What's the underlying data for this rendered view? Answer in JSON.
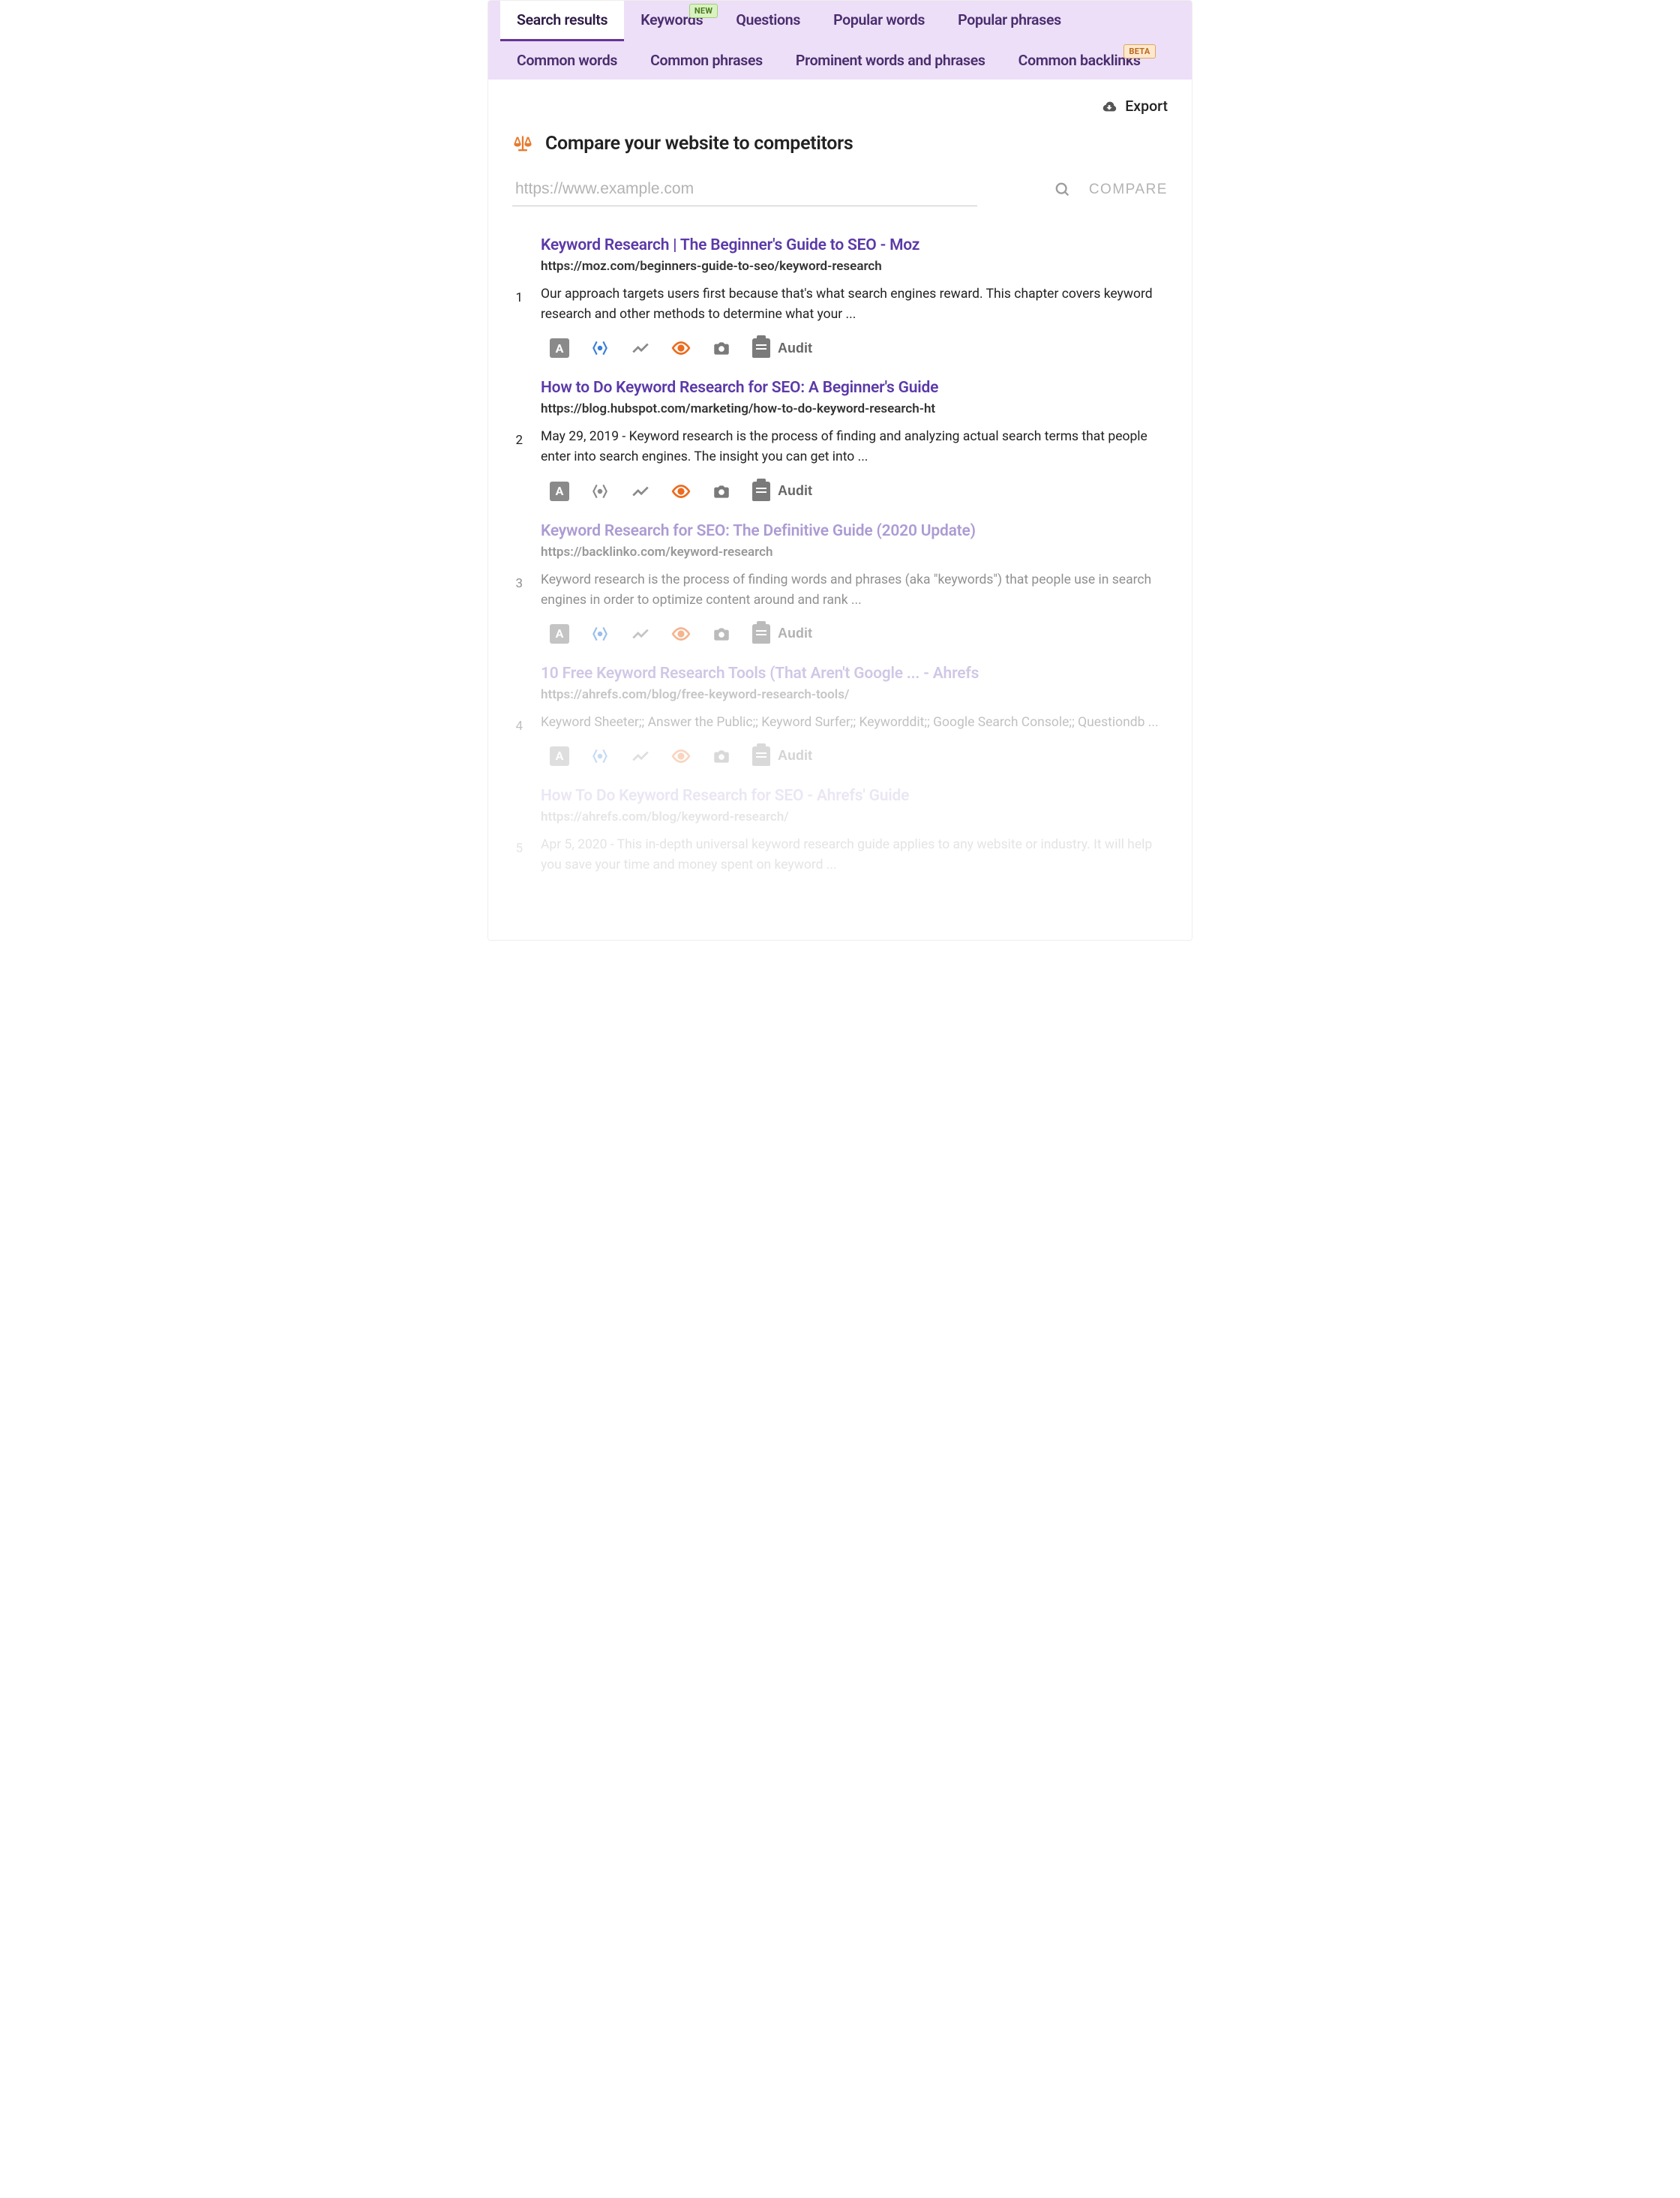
{
  "tabs_row1": [
    {
      "label": "Search results",
      "active": true,
      "name": "tab-search-results"
    },
    {
      "label": "Keywords",
      "badge": "NEW",
      "badge_kind": "new",
      "name": "tab-keywords"
    },
    {
      "label": "Questions",
      "name": "tab-questions"
    },
    {
      "label": "Popular words",
      "name": "tab-popular-words"
    },
    {
      "label": "Popular phrases",
      "name": "tab-popular-phrases"
    }
  ],
  "tabs_row2": [
    {
      "label": "Common words",
      "name": "tab-common-words"
    },
    {
      "label": "Common phrases",
      "name": "tab-common-phrases"
    },
    {
      "label": "Prominent words and phrases",
      "name": "tab-prominent-words-phrases"
    },
    {
      "label": "Common backlinks",
      "badge": "BETA",
      "badge_kind": "beta",
      "name": "tab-common-backlinks"
    }
  ],
  "export_label": "Export",
  "compare": {
    "title": "Compare your website to competitors",
    "placeholder": "https://www.example.com",
    "button": "COMPARE"
  },
  "audit_label": "Audit",
  "results": [
    {
      "num": "1",
      "title": "Keyword Research | The Beginner's Guide to SEO - Moz",
      "url": "https://moz.com/beginners-guide-to-seo/keyword-research",
      "snippet": "Our approach targets users first because that's what search engines reward. This chapter covers keyword research and other methods to determine what your ...",
      "schema_blue": true,
      "fade": ""
    },
    {
      "num": "2",
      "title": "How to Do Keyword Research for SEO: A Beginner's Guide",
      "url": "https://blog.hubspot.com/marketing/how-to-do-keyword-research-ht",
      "snippet": "May 29, 2019 - Keyword research is the process of finding and analyzing actual search terms that people enter into search engines. The insight you can get into ...",
      "schema_blue": false,
      "fade": ""
    },
    {
      "num": "3",
      "title": "Keyword Research for SEO: The Definitive Guide (2020 Update)",
      "url": "https://backlinko.com/keyword-research",
      "snippet": "Keyword research is the process of finding words and phrases (aka \"keywords\") that people use in search engines in order to optimize content around and rank ...",
      "schema_blue": true,
      "fade": "faded"
    },
    {
      "num": "4",
      "title": "10 Free Keyword Research Tools (That Aren't Google ... - Ahrefs",
      "url": "https://ahrefs.com/blog/free-keyword-research-tools/",
      "snippet": "Keyword Sheeter;; Answer the Public;; Keyword Surfer;; Keyworddit;; Google Search Console;; Questiondb ...",
      "schema_blue": true,
      "fade": "faded-more"
    },
    {
      "num": "5",
      "title": "How To Do Keyword Research for SEO - Ahrefs' Guide",
      "url": "https://ahrefs.com/blog/keyword-research/",
      "snippet": "Apr 5, 2020 - This in-depth universal keyword research guide applies to any website or industry. It will help you save your time and money spent on keyword ...",
      "schema_blue": true,
      "fade": "faded-most",
      "hide_tools": true
    }
  ]
}
